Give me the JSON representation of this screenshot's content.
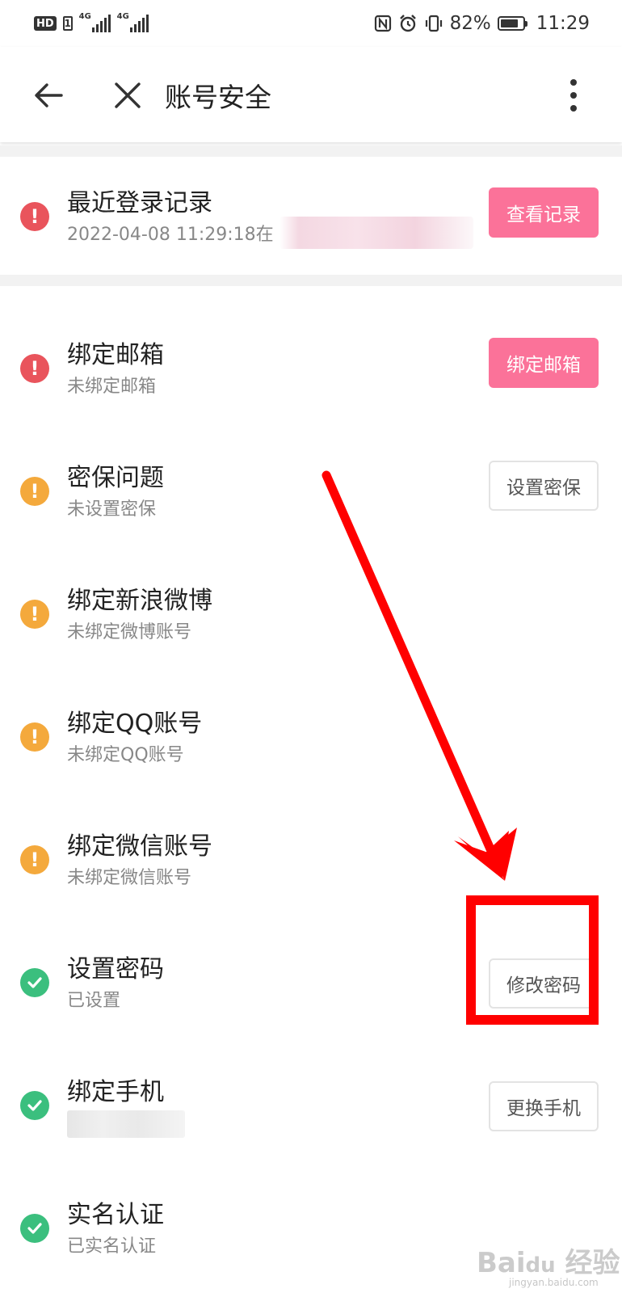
{
  "status_bar": {
    "hd": "HD",
    "sim": "1",
    "net1": "4G",
    "net2": "4G",
    "battery": "82%",
    "battery_level": 0.82,
    "time": "11:29"
  },
  "nav": {
    "title": "账号安全"
  },
  "rows": {
    "login": {
      "title": "最近登录记录",
      "subtitle": "2022-04-08 11:29:18在",
      "button": "查看记录",
      "status": "warning-red"
    },
    "email": {
      "title": "绑定邮箱",
      "subtitle": "未绑定邮箱",
      "button": "绑定邮箱",
      "status": "warning-red"
    },
    "security_question": {
      "title": "密保问题",
      "subtitle": "未设置密保",
      "button": "设置密保",
      "status": "warning-orange"
    },
    "weibo": {
      "title": "绑定新浪微博",
      "subtitle": "未绑定微博账号",
      "status": "warning-orange"
    },
    "qq": {
      "title": "绑定QQ账号",
      "subtitle": "未绑定QQ账号",
      "status": "warning-orange"
    },
    "wechat": {
      "title": "绑定微信账号",
      "subtitle": "未绑定微信账号",
      "status": "warning-orange"
    },
    "password": {
      "title": "设置密码",
      "subtitle": "已设置",
      "button": "修改密码",
      "status": "ok-green"
    },
    "phone": {
      "title": "绑定手机",
      "button": "更换手机",
      "status": "ok-green"
    },
    "realname": {
      "title": "实名认证",
      "subtitle": "已实名认证",
      "status": "ok-green"
    }
  },
  "icons": {
    "back": "arrow-left-icon",
    "close": "close-icon",
    "more": "more-vertical-icon",
    "alert": "exclamation-circle-icon",
    "check": "check-circle-icon"
  },
  "colors": {
    "red": "#e9545c",
    "orange": "#f4a93c",
    "green": "#3bbf7e",
    "pink_button": "#fb7299",
    "annotation": "#ff0000"
  },
  "watermark": {
    "brand": "Bai du 经验",
    "url": "jingyan.baidu.com"
  }
}
